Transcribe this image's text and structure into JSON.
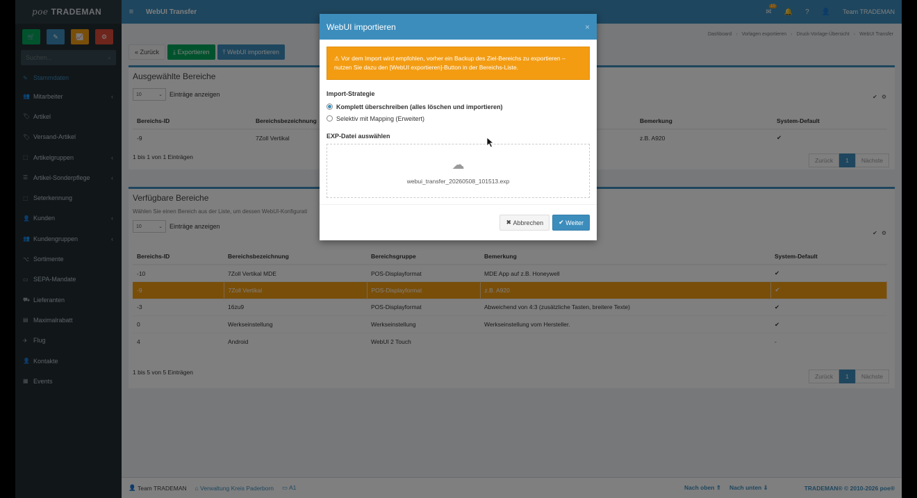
{
  "colors": {
    "primary": "#3c8dbc",
    "success": "#00a65a",
    "warning": "#f39c12",
    "danger": "#dd4b39",
    "sidebar": "#222d32"
  },
  "sidebar": {
    "logo_poe": "poe",
    "logo_text": "TRADEMAN",
    "quick_buttons": [
      {
        "icon": "cart-icon",
        "color": "#00a65a"
      },
      {
        "icon": "pencil-icon",
        "color": "#3c8dbc"
      },
      {
        "icon": "chart-icon",
        "color": "#f39c12"
      },
      {
        "icon": "gears-icon",
        "color": "#dd4b39"
      }
    ],
    "search_placeholder": "Suchen...",
    "active_item": "Stammdaten",
    "items": [
      {
        "label": "Mitarbeiter",
        "icon": "users-icon",
        "submenu": true
      },
      {
        "label": "Artikel",
        "icon": "tag-icon",
        "submenu": false
      },
      {
        "label": "Versand-Artikel",
        "icon": "tag-icon",
        "submenu": false
      },
      {
        "label": "Artikelgruppen",
        "icon": "cubes-icon",
        "submenu": true
      },
      {
        "label": "Artikel-Sonderpflege",
        "icon": "list-icon",
        "submenu": true
      },
      {
        "label": "Seterkennung",
        "icon": "cubes-icon",
        "submenu": false
      },
      {
        "label": "Kunden",
        "icon": "user-icon",
        "submenu": true
      },
      {
        "label": "Kundengruppen",
        "icon": "users-icon",
        "submenu": true
      },
      {
        "label": "Sortimente",
        "icon": "sitemap-icon",
        "submenu": false
      },
      {
        "label": "SEPA-Mandate",
        "icon": "credit-card-icon",
        "submenu": false
      },
      {
        "label": "Lieferanten",
        "icon": "truck-icon",
        "submenu": false
      },
      {
        "label": "Maximalrabatt",
        "icon": "money-icon",
        "submenu": false
      },
      {
        "label": "Flug",
        "icon": "plane-icon",
        "submenu": false
      },
      {
        "label": "Kontakte",
        "icon": "user-plus-icon",
        "submenu": false
      },
      {
        "label": "Events",
        "icon": "calendar-icon",
        "submenu": false
      }
    ]
  },
  "header": {
    "title": "WebUI Transfer",
    "mail_badge": "10",
    "user": "Team TRADEMAN"
  },
  "breadcrumb": [
    "Dashboard",
    "Vorlagen exportieren",
    "Druck-Vorlage-Übersicht",
    "WebUI Transfer"
  ],
  "toolbar": {
    "back": "Zurück",
    "export": "Exportieren",
    "import": "WebUI importieren"
  },
  "selected_box": {
    "title": "Ausgewählte Bereiche",
    "length_value": "10",
    "length_label": "Einträge anzeigen",
    "columns": [
      "Bereichs-ID",
      "Bereichsbezeichnung",
      "Bemerkung",
      "System-Default"
    ],
    "rows": [
      {
        "id": "-9",
        "name": "7Zoll Vertikal",
        "remark": "z.B. A920",
        "default": "✔"
      }
    ],
    "info": "1 bis 1 von 1 Einträgen"
  },
  "available_box": {
    "title": "Verfügbare Bereiche",
    "hint": "Wählen Sie einen Bereich aus der Liste, um dessen WebUI-Konfigurati",
    "length_value": "10",
    "length_label": "Einträge anzeigen",
    "columns": [
      "Bereichs-ID",
      "Bereichsbezeichnung",
      "Bereichsgruppe",
      "Bemerkung",
      "System-Default"
    ],
    "rows": [
      {
        "id": "-10",
        "name": "7Zoll Vertikal MDE",
        "group": "POS-Displayformat",
        "remark": "MDE App auf z.B. Honeywell",
        "default": "✔",
        "highlight": false
      },
      {
        "id": "-9",
        "name": "7Zoll Vertikal",
        "group": "POS-Displayformat",
        "remark": "z.B. A920",
        "default": "✔",
        "highlight": true
      },
      {
        "id": "-3",
        "name": "16zu9",
        "group": "POS-Displayformat",
        "remark": "Abweichend von 4:3 (zusätzliche Tasten, breitere Texte)",
        "default": "✔",
        "highlight": false
      },
      {
        "id": "0",
        "name": "Werkseinstellung",
        "group": "Werkseinstellung",
        "remark": "Werkseinstellung vom Hersteller.",
        "default": "✔",
        "highlight": false
      },
      {
        "id": "4",
        "name": "Android",
        "group": "WebUI 2 Touch",
        "remark": "",
        "default": "-",
        "highlight": false
      }
    ],
    "info": "1 bis 5 von 5 Einträgen"
  },
  "pager": {
    "prev": "Zurück",
    "page": "1",
    "next": "Nächste"
  },
  "footer": {
    "user": "Team TRADEMAN",
    "org": "Verwaltung Kreis Paderborn",
    "device": "A1",
    "up": "Nach oben",
    "down": "Nach unten",
    "brand": "TRADEMAN",
    "copyright": "® © 2010-2026 poe®"
  },
  "modal": {
    "title": "WebUI importieren",
    "warning": "Vor dem Import wird empfohlen, vorher ein Backup des Ziel-Bereichs zu exportieren – nutzen Sie dazu den [WebUI exportieren]-Button in der Bereichs-Liste.",
    "strategy_label": "Import-Strategie",
    "option_full": "Komplett überschreiben (alles löschen und importieren)",
    "option_selective": "Selektiv mit Mapping (Erweitert)",
    "file_label": "EXP-Datei auswählen",
    "file_name": "webui_transfer_20260508_101513.exp",
    "cancel": "Abbrechen",
    "next": "Weiter"
  }
}
